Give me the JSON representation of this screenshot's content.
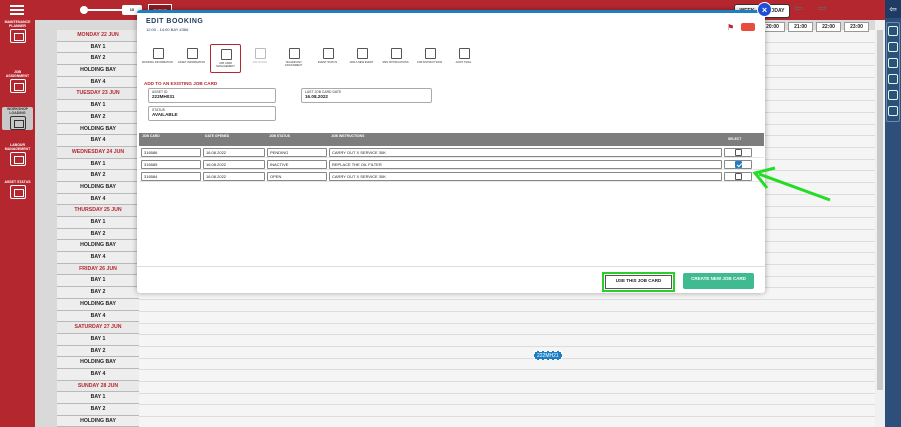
{
  "topbar": {
    "zoom_value": "10",
    "event_label": "EVENT"
  },
  "nav": {
    "week": "WEEK",
    "today": "TODAY",
    "prev_icon": "arrow-left-icon",
    "next_icon": "arrow-right-icon"
  },
  "time_header": [
    "20:00",
    "21:00",
    "22:00",
    "23:00"
  ],
  "sidebar": {
    "menu_icon": "hamburger-icon",
    "items": [
      {
        "label": "MAINTENANCE PLANNER",
        "icon": "planner-icon"
      },
      {
        "label": "JOB ASSIGNMENT",
        "icon": "job-assignment-icon"
      },
      {
        "label": "WORKSHOP LOADING",
        "icon": "workshop-icon"
      },
      {
        "label": "LABOUR MANAGEMENT",
        "icon": "labour-icon"
      },
      {
        "label": "ASSET STATUS",
        "icon": "asset-status-icon"
      }
    ]
  },
  "schedule_rows": [
    {
      "label": "MONDAY 22 JUN",
      "type": "day"
    },
    {
      "label": "BAY 1",
      "type": "bay"
    },
    {
      "label": "BAY 2",
      "type": "bay"
    },
    {
      "label": "HOLDING BAY",
      "type": "bay"
    },
    {
      "label": "BAY 4",
      "type": "bay"
    },
    {
      "label": "TUESDAY 23 JUN",
      "type": "day"
    },
    {
      "label": "BAY 1",
      "type": "bay"
    },
    {
      "label": "BAY 2",
      "type": "bay"
    },
    {
      "label": "HOLDING BAY",
      "type": "bay"
    },
    {
      "label": "BAY 4",
      "type": "bay"
    },
    {
      "label": "WEDNESDAY 24 JUN",
      "type": "day"
    },
    {
      "label": "BAY 1",
      "type": "bay"
    },
    {
      "label": "BAY 2",
      "type": "bay"
    },
    {
      "label": "HOLDING BAY",
      "type": "bay"
    },
    {
      "label": "BAY 4",
      "type": "bay"
    },
    {
      "label": "THURSDAY 25 JUN",
      "type": "day"
    },
    {
      "label": "BAY 1",
      "type": "bay"
    },
    {
      "label": "BAY 2",
      "type": "bay"
    },
    {
      "label": "HOLDING BAY",
      "type": "bay"
    },
    {
      "label": "BAY 4",
      "type": "bay"
    },
    {
      "label": "FRIDAY 26 JUN",
      "type": "day"
    },
    {
      "label": "BAY 1",
      "type": "bay"
    },
    {
      "label": "BAY 2",
      "type": "bay"
    },
    {
      "label": "HOLDING BAY",
      "type": "bay"
    },
    {
      "label": "BAY 4",
      "type": "bay"
    },
    {
      "label": "SATURDAY 27 JUN",
      "type": "day"
    },
    {
      "label": "BAY 1",
      "type": "bay"
    },
    {
      "label": "BAY 2",
      "type": "bay"
    },
    {
      "label": "HOLDING BAY",
      "type": "bay"
    },
    {
      "label": "BAY 4",
      "type": "bay"
    },
    {
      "label": "SUNDAY 28 JUN",
      "type": "day"
    },
    {
      "label": "BAY 1",
      "type": "bay"
    },
    {
      "label": "BAY 2",
      "type": "bay"
    },
    {
      "label": "HOLDING BAY",
      "type": "bay"
    }
  ],
  "vehicle_tag": "222MH21",
  "modal": {
    "title": "EDIT BOOKING",
    "subtitle": "12:00 - 14:00   BAY #366",
    "close_icon": "close-icon",
    "flag_icon": "flag-icon",
    "tabs": [
      {
        "label": "BOOKING INFORMATION",
        "icon": "booking-icon",
        "state": "normal"
      },
      {
        "label": "ASSET INFORMATION",
        "icon": "truck-icon",
        "state": "normal"
      },
      {
        "label": "JOB CARD MANAGEMENT",
        "icon": "tools-icon",
        "state": "active"
      },
      {
        "label": "JOB NOTES",
        "icon": "notes-icon",
        "state": "dim"
      },
      {
        "label": "TECHNICIAN ASSIGNMENT",
        "icon": "technician-icon",
        "state": "normal"
      },
      {
        "label": "EVENT STATUS",
        "icon": "event-status-icon",
        "state": "normal"
      },
      {
        "label": "ADD A NEW EVENT",
        "icon": "add-event-icon",
        "state": "normal"
      },
      {
        "label": "SMS NOTIFICATIONS",
        "icon": "sms-icon",
        "state": "normal"
      },
      {
        "label": "JOB INSTRUCTIONS",
        "icon": "instructions-icon",
        "state": "normal"
      },
      {
        "label": "AUDIT TRAIL",
        "icon": "audit-icon",
        "state": "normal"
      }
    ],
    "section_title": "ADD TO AN EXISTING JOB CARD",
    "fields": {
      "asset_id_label": "ASSET ID",
      "asset_id_value": "222MH031",
      "last_job_label": "LAST JOB CARD DATE",
      "last_job_value": "16.08.2022",
      "status_label": "STATUS",
      "status_value": "AVAILABLE"
    },
    "table": {
      "headers": [
        "JOB CARD",
        "DATE OPENED",
        "JOB STATUS",
        "JOB INSTRUCTIONS",
        "SELECT"
      ],
      "rows": [
        {
          "card": "316586",
          "date": "16.08.2022",
          "status": "PENDING",
          "instructions": "CARRY OUT X SERVICE 30K",
          "selected": false
        },
        {
          "card": "316585",
          "date": "16.08.2022",
          "status": "INACTIVE",
          "instructions": "REPLACE THE OIL FILTER",
          "selected": true
        },
        {
          "card": "316584",
          "date": "16.08.2022",
          "status": "OPEN",
          "instructions": "CARRY OUT X SERVICE 30K",
          "selected": false
        }
      ]
    },
    "use_button": "USE THIS JOB CARD",
    "new_button": "CREATE NEW JOB CARD"
  },
  "colors": {
    "brand_red": "#b5272f",
    "accent_blue": "#1d7fc1",
    "create_green": "#3fba91",
    "highlight_green": "#28d028"
  }
}
